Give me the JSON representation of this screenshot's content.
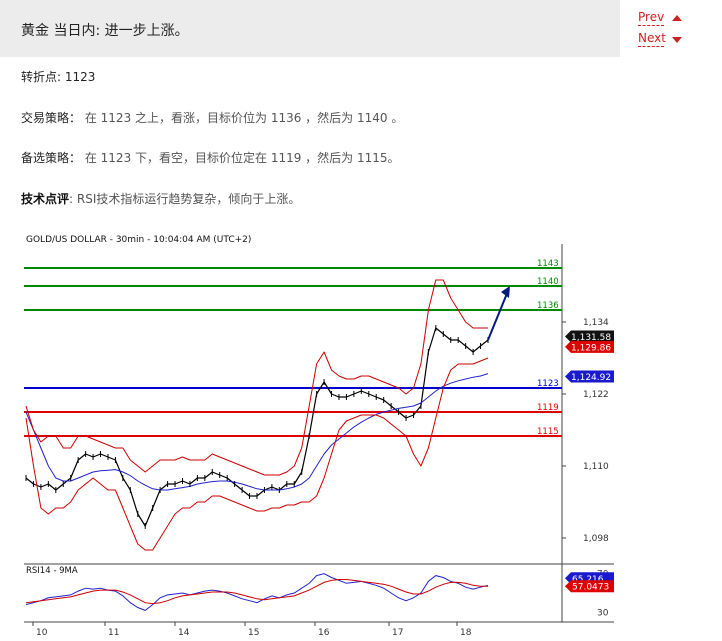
{
  "header": {
    "title": "黄金 当日内: 进一步上涨。",
    "prev_label": "Prev",
    "next_label": "Next"
  },
  "analysis": {
    "pivot_label": "转折点:",
    "pivot_value": "1123",
    "strategy_label": "交易策略：",
    "strategy_text": "在 1123 之上，看涨，目标价位为 1136 ，然后为 1140 。",
    "alt_label": "备选策略：",
    "alt_text": "在 1123 下，看空，目标价位定在 1119 ，然后为 1115。",
    "comment_label": "技术点评",
    "comment_text": ": RSI技术指标运行趋势复杂，倾向于上涨。"
  },
  "colors": {
    "resistance": "#008800",
    "pivot": "#0000cc",
    "support": "#dd0000",
    "bollinger": "#cc0000",
    "ma": "#2222cc",
    "price": "#000000",
    "arrow": "#001a80"
  },
  "chart_data": {
    "type": "line",
    "title": "GOLD/US DOLLAR - 30min - 10:04:04 AM (UTC+2)",
    "x_ticks": [
      "10",
      "11",
      "14",
      "15",
      "16",
      "17",
      "18"
    ],
    "y_ticks": [
      1134,
      1122,
      1110,
      1098
    ],
    "ylim": [
      1094,
      1147
    ],
    "levels": [
      {
        "label": "1143",
        "value": 1143,
        "kind": "resistance"
      },
      {
        "label": "1140",
        "value": 1140,
        "kind": "resistance"
      },
      {
        "label": "1136",
        "value": 1136,
        "kind": "resistance"
      },
      {
        "label": "1123",
        "value": 1123,
        "kind": "pivot"
      },
      {
        "label": "1119",
        "value": 1119,
        "kind": "support"
      },
      {
        "label": "1115",
        "value": 1115,
        "kind": "support"
      }
    ],
    "price_badges": [
      {
        "label": "1,131.58",
        "value": 1131.58,
        "bg": "#111111",
        "fg": "#ffffff"
      },
      {
        "label": "1,129.86",
        "value": 1129.86,
        "bg": "#dd0000",
        "fg": "#ffffff"
      },
      {
        "label": "1,124.92",
        "value": 1124.92,
        "bg": "#1a1acc",
        "fg": "#ffffff"
      }
    ],
    "series": [
      {
        "values": [
          1108,
          1107,
          1106.5,
          1107,
          1106,
          1107,
          1108,
          1111,
          1112,
          1111.5,
          1112,
          1111.5,
          1111,
          1108,
          1106,
          1102,
          1100,
          1103,
          1106,
          1107,
          1107,
          1107.5,
          1107,
          1108,
          1108,
          1109,
          1108.5,
          1108,
          1107,
          1106,
          1105,
          1105,
          1106,
          1106.5,
          1106,
          1107,
          1107,
          1109,
          1115,
          1122,
          1124,
          1122,
          1121.5,
          1121.5,
          1122,
          1122.5,
          1122,
          1121.5,
          1121,
          1120,
          1119,
          1118,
          1118.5,
          1120,
          1129,
          1133,
          1132,
          1131,
          1131,
          1130,
          1129,
          1130,
          1131
        ]
      },
      {
        "values": [
          1119,
          1116,
          1113,
          1110,
          1108,
          1107.5,
          1107.5,
          1108,
          1108.5,
          1109,
          1109.2,
          1109.3,
          1109.4,
          1109,
          1108.4,
          1107.5,
          1106.8,
          1106.2,
          1106,
          1106,
          1106.2,
          1106.4,
          1106.6,
          1107,
          1107.2,
          1107.4,
          1107.5,
          1107.5,
          1107.3,
          1107,
          1106.6,
          1106.2,
          1106,
          1106,
          1106,
          1106.2,
          1106.5,
          1107,
          1108,
          1110,
          1112,
          1113.5,
          1114.5,
          1115.5,
          1116.5,
          1117.3,
          1118,
          1118.6,
          1119,
          1119.3,
          1119.6,
          1119.8,
          1120,
          1120.5,
          1121.5,
          1122.5,
          1123.3,
          1123.8,
          1124.2,
          1124.5,
          1124.8,
          1125,
          1125.4
        ]
      },
      {
        "values": [
          1120,
          1116,
          1114,
          1115,
          1115,
          1113,
          1113,
          1115,
          1115,
          1114.5,
          1114,
          1113.5,
          1113,
          1113,
          1111,
          1110,
          1109,
          1110,
          1111,
          1111,
          1111,
          1111.5,
          1111,
          1111,
          1111,
          1112,
          1111.5,
          1111,
          1110.5,
          1110,
          1109.5,
          1109,
          1108.5,
          1108.5,
          1108.5,
          1109,
          1110,
          1113,
          1120,
          1127,
          1129,
          1126,
          1125,
          1124.5,
          1124.5,
          1125,
          1125,
          1124.5,
          1124,
          1123.5,
          1123,
          1122,
          1123,
          1127,
          1136,
          1141,
          1141,
          1138,
          1136,
          1134,
          1133,
          1133,
          1133
        ]
      },
      {
        "values": [
          1118,
          1110,
          1103,
          1102,
          1103,
          1103,
          1104,
          1106,
          1107,
          1108,
          1107,
          1106,
          1106,
          1103,
          1100,
          1097,
          1096,
          1096,
          1098,
          1100,
          1102,
          1103,
          1103,
          1104,
          1104,
          1105,
          1105,
          1104.5,
          1104,
          1103.5,
          1103,
          1102.5,
          1102.5,
          1103,
          1103,
          1103.5,
          1103.5,
          1104,
          1104,
          1105,
          1108,
          1112,
          1116,
          1117.5,
          1118,
          1118.5,
          1118.5,
          1118.5,
          1118,
          1117,
          1116,
          1115,
          1112,
          1110,
          1113,
          1118,
          1123,
          1126,
          1127,
          1127,
          1127,
          1127.5,
          1128
        ]
      }
    ],
    "forecast_arrow": {
      "from": 1131,
      "to": 1140
    },
    "rsi": {
      "title": "RSI14 - 9MA",
      "y_ticks": [
        70,
        30
      ],
      "ylim": [
        20,
        80
      ],
      "badges": [
        {
          "label": "65.216",
          "value": 65.216,
          "bg": "#1a1acc",
          "fg": "#ffffff"
        },
        {
          "label": "57.0473",
          "value": 57.0473,
          "bg": "#dd0000",
          "fg": "#ffffff"
        }
      ],
      "series": [
        {
          "values": [
            38,
            40,
            42,
            45,
            46,
            47,
            48,
            52,
            55,
            54,
            55,
            53,
            52,
            47,
            40,
            35,
            32,
            38,
            45,
            48,
            49,
            50,
            48,
            50,
            52,
            53,
            52,
            50,
            47,
            44,
            42,
            40,
            44,
            47,
            45,
            48,
            50,
            55,
            60,
            68,
            70,
            66,
            63,
            60,
            61,
            62,
            60,
            58,
            55,
            50,
            45,
            42,
            45,
            50,
            62,
            68,
            66,
            62,
            60,
            56,
            54,
            56,
            58
          ]
        },
        {
          "values": [
            40,
            41,
            42,
            43,
            44,
            45,
            46,
            48,
            50,
            52,
            53,
            53,
            53,
            51,
            48,
            44,
            40,
            39,
            40,
            42,
            45,
            47,
            48,
            49,
            50,
            51,
            51,
            51,
            50,
            48,
            46,
            44,
            43,
            44,
            45,
            46,
            47,
            50,
            53,
            57,
            61,
            63,
            64,
            64,
            63,
            62,
            61,
            60,
            59,
            57,
            54,
            51,
            49,
            49,
            52,
            56,
            59,
            61,
            61,
            60,
            58,
            57,
            57
          ]
        }
      ]
    }
  }
}
